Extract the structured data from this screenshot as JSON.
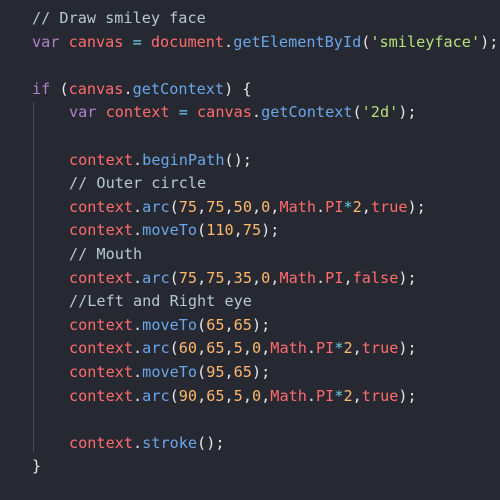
{
  "colors": {
    "background": "#262932",
    "comment": "#b6c8d2",
    "keyword": "#ae81c8",
    "identifier": "#ff6b6b",
    "function": "#6aa6e8",
    "string": "#b7e07b",
    "number": "#ffb86c",
    "punctuation": "#e6e6e6",
    "operator": "#67d1e6"
  },
  "code": {
    "lines": [
      {
        "indent": 0,
        "tokens": [
          {
            "t": "comment",
            "v": "// Draw smiley face"
          }
        ]
      },
      {
        "indent": 0,
        "tokens": [
          {
            "t": "keyword",
            "v": "var "
          },
          {
            "t": "ident",
            "v": "canvas"
          },
          {
            "t": "op",
            "v": " = "
          },
          {
            "t": "ident",
            "v": "document"
          },
          {
            "t": "dot",
            "v": "."
          },
          {
            "t": "func",
            "v": "getElementById"
          },
          {
            "t": "punct",
            "v": "("
          },
          {
            "t": "string",
            "v": "'smileyface'"
          },
          {
            "t": "punct",
            "v": ");"
          }
        ]
      },
      {
        "indent": 0,
        "tokens": []
      },
      {
        "indent": 0,
        "tokens": [
          {
            "t": "keyword",
            "v": "if "
          },
          {
            "t": "punct",
            "v": "("
          },
          {
            "t": "ident",
            "v": "canvas"
          },
          {
            "t": "dot",
            "v": "."
          },
          {
            "t": "func",
            "v": "getContext"
          },
          {
            "t": "punct",
            "v": ") {"
          }
        ]
      },
      {
        "indent": 1,
        "tokens": [
          {
            "t": "keyword",
            "v": "var "
          },
          {
            "t": "ident",
            "v": "context"
          },
          {
            "t": "op",
            "v": " = "
          },
          {
            "t": "ident",
            "v": "canvas"
          },
          {
            "t": "dot",
            "v": "."
          },
          {
            "t": "func",
            "v": "getContext"
          },
          {
            "t": "punct",
            "v": "("
          },
          {
            "t": "string",
            "v": "'2d'"
          },
          {
            "t": "punct",
            "v": ");"
          }
        ]
      },
      {
        "indent": 1,
        "tokens": []
      },
      {
        "indent": 1,
        "tokens": [
          {
            "t": "ident",
            "v": "context"
          },
          {
            "t": "dot",
            "v": "."
          },
          {
            "t": "func",
            "v": "beginPath"
          },
          {
            "t": "punct",
            "v": "();"
          }
        ]
      },
      {
        "indent": 1,
        "tokens": [
          {
            "t": "comment",
            "v": "// Outer circle"
          }
        ]
      },
      {
        "indent": 1,
        "tokens": [
          {
            "t": "ident",
            "v": "context"
          },
          {
            "t": "dot",
            "v": "."
          },
          {
            "t": "func",
            "v": "arc"
          },
          {
            "t": "punct",
            "v": "("
          },
          {
            "t": "number",
            "v": "75"
          },
          {
            "t": "punct",
            "v": ","
          },
          {
            "t": "number",
            "v": "75"
          },
          {
            "t": "punct",
            "v": ","
          },
          {
            "t": "number",
            "v": "50"
          },
          {
            "t": "punct",
            "v": ","
          },
          {
            "t": "number",
            "v": "0"
          },
          {
            "t": "punct",
            "v": ","
          },
          {
            "t": "ident",
            "v": "Math"
          },
          {
            "t": "dot",
            "v": "."
          },
          {
            "t": "ident",
            "v": "PI"
          },
          {
            "t": "op",
            "v": "*"
          },
          {
            "t": "number",
            "v": "2"
          },
          {
            "t": "punct",
            "v": ","
          },
          {
            "t": "bool",
            "v": "true"
          },
          {
            "t": "punct",
            "v": ");"
          }
        ]
      },
      {
        "indent": 1,
        "tokens": [
          {
            "t": "ident",
            "v": "context"
          },
          {
            "t": "dot",
            "v": "."
          },
          {
            "t": "func",
            "v": "moveTo"
          },
          {
            "t": "punct",
            "v": "("
          },
          {
            "t": "number",
            "v": "110"
          },
          {
            "t": "punct",
            "v": ","
          },
          {
            "t": "number",
            "v": "75"
          },
          {
            "t": "punct",
            "v": ");"
          }
        ]
      },
      {
        "indent": 1,
        "tokens": [
          {
            "t": "comment",
            "v": "// Mouth"
          }
        ]
      },
      {
        "indent": 1,
        "tokens": [
          {
            "t": "ident",
            "v": "context"
          },
          {
            "t": "dot",
            "v": "."
          },
          {
            "t": "func",
            "v": "arc"
          },
          {
            "t": "punct",
            "v": "("
          },
          {
            "t": "number",
            "v": "75"
          },
          {
            "t": "punct",
            "v": ","
          },
          {
            "t": "number",
            "v": "75"
          },
          {
            "t": "punct",
            "v": ","
          },
          {
            "t": "number",
            "v": "35"
          },
          {
            "t": "punct",
            "v": ","
          },
          {
            "t": "number",
            "v": "0"
          },
          {
            "t": "punct",
            "v": ","
          },
          {
            "t": "ident",
            "v": "Math"
          },
          {
            "t": "dot",
            "v": "."
          },
          {
            "t": "ident",
            "v": "PI"
          },
          {
            "t": "punct",
            "v": ","
          },
          {
            "t": "bool",
            "v": "false"
          },
          {
            "t": "punct",
            "v": ");"
          }
        ]
      },
      {
        "indent": 1,
        "tokens": [
          {
            "t": "comment",
            "v": "//Left and Right eye"
          }
        ]
      },
      {
        "indent": 1,
        "tokens": [
          {
            "t": "ident",
            "v": "context"
          },
          {
            "t": "dot",
            "v": "."
          },
          {
            "t": "func",
            "v": "moveTo"
          },
          {
            "t": "punct",
            "v": "("
          },
          {
            "t": "number",
            "v": "65"
          },
          {
            "t": "punct",
            "v": ","
          },
          {
            "t": "number",
            "v": "65"
          },
          {
            "t": "punct",
            "v": ");"
          }
        ]
      },
      {
        "indent": 1,
        "tokens": [
          {
            "t": "ident",
            "v": "context"
          },
          {
            "t": "dot",
            "v": "."
          },
          {
            "t": "func",
            "v": "arc"
          },
          {
            "t": "punct",
            "v": "("
          },
          {
            "t": "number",
            "v": "60"
          },
          {
            "t": "punct",
            "v": ","
          },
          {
            "t": "number",
            "v": "65"
          },
          {
            "t": "punct",
            "v": ","
          },
          {
            "t": "number",
            "v": "5"
          },
          {
            "t": "punct",
            "v": ","
          },
          {
            "t": "number",
            "v": "0"
          },
          {
            "t": "punct",
            "v": ","
          },
          {
            "t": "ident",
            "v": "Math"
          },
          {
            "t": "dot",
            "v": "."
          },
          {
            "t": "ident",
            "v": "PI"
          },
          {
            "t": "op",
            "v": "*"
          },
          {
            "t": "number",
            "v": "2"
          },
          {
            "t": "punct",
            "v": ","
          },
          {
            "t": "bool",
            "v": "true"
          },
          {
            "t": "punct",
            "v": ");"
          }
        ]
      },
      {
        "indent": 1,
        "tokens": [
          {
            "t": "ident",
            "v": "context"
          },
          {
            "t": "dot",
            "v": "."
          },
          {
            "t": "func",
            "v": "moveTo"
          },
          {
            "t": "punct",
            "v": "("
          },
          {
            "t": "number",
            "v": "95"
          },
          {
            "t": "punct",
            "v": ","
          },
          {
            "t": "number",
            "v": "65"
          },
          {
            "t": "punct",
            "v": ");"
          }
        ]
      },
      {
        "indent": 1,
        "tokens": [
          {
            "t": "ident",
            "v": "context"
          },
          {
            "t": "dot",
            "v": "."
          },
          {
            "t": "func",
            "v": "arc"
          },
          {
            "t": "punct",
            "v": "("
          },
          {
            "t": "number",
            "v": "90"
          },
          {
            "t": "punct",
            "v": ","
          },
          {
            "t": "number",
            "v": "65"
          },
          {
            "t": "punct",
            "v": ","
          },
          {
            "t": "number",
            "v": "5"
          },
          {
            "t": "punct",
            "v": ","
          },
          {
            "t": "number",
            "v": "0"
          },
          {
            "t": "punct",
            "v": ","
          },
          {
            "t": "ident",
            "v": "Math"
          },
          {
            "t": "dot",
            "v": "."
          },
          {
            "t": "ident",
            "v": "PI"
          },
          {
            "t": "op",
            "v": "*"
          },
          {
            "t": "number",
            "v": "2"
          },
          {
            "t": "punct",
            "v": ","
          },
          {
            "t": "bool",
            "v": "true"
          },
          {
            "t": "punct",
            "v": ");"
          }
        ]
      },
      {
        "indent": 1,
        "tokens": []
      },
      {
        "indent": 1,
        "tokens": [
          {
            "t": "ident",
            "v": "context"
          },
          {
            "t": "dot",
            "v": "."
          },
          {
            "t": "func",
            "v": "stroke"
          },
          {
            "t": "punct",
            "v": "();"
          }
        ]
      },
      {
        "indent": 0,
        "tokens": [
          {
            "t": "punct",
            "v": "}"
          }
        ]
      }
    ]
  }
}
